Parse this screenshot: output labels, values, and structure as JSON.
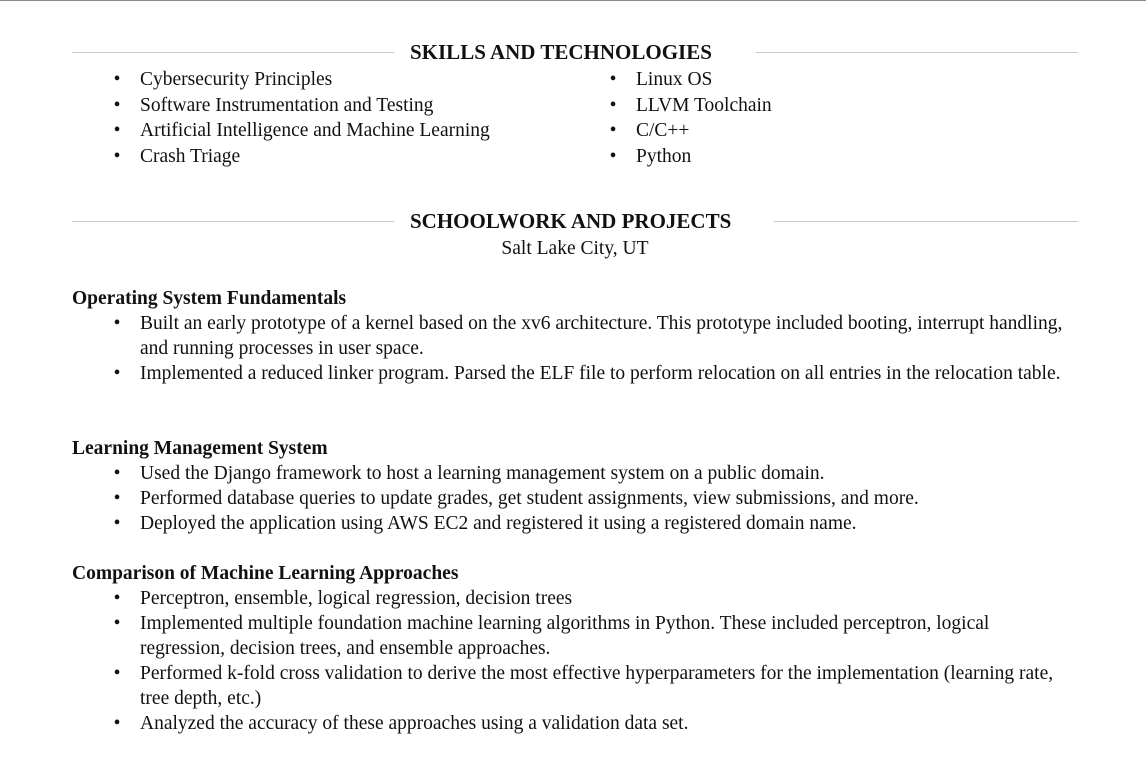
{
  "bullet_glyph": "•",
  "skills": {
    "heading": "SKILLS AND TECHNOLOGIES",
    "left_items": [
      "Cybersecurity Principles",
      "Software Instrumentation and Testing",
      "Artificial Intelligence and Machine Learning",
      "Crash Triage"
    ],
    "right_items": [
      "Linux OS",
      "LLVM Toolchain",
      "C/C++",
      "Python"
    ]
  },
  "projects": {
    "heading": "SCHOOLWORK AND PROJECTS",
    "location": "Salt Lake City, UT",
    "items": [
      {
        "title": "Operating System Fundamentals",
        "bullets": [
          "Built an early prototype of a kernel based on the xv6 architecture. This prototype included booting, interrupt handling, and running processes in user space.",
          "Implemented a reduced linker program. Parsed the ELF file to perform relocation on all entries in the relocation table."
        ]
      },
      {
        "title": "Learning Management System",
        "bullets": [
          "Used the Django framework to host a learning management system on a public domain.",
          "Performed database queries to update grades, get student assignments, view submissions, and more.",
          "Deployed the application using AWS EC2 and registered it using a registered domain name."
        ]
      },
      {
        "title": "Comparison of Machine Learning Approaches",
        "bullets": [
          "Perceptron, ensemble, logical regression, decision trees",
          "Implemented multiple foundation machine learning algorithms in Python. These included perceptron, logical regression, decision trees, and ensemble approaches.",
          "Performed k-fold cross validation to derive the most effective hyperparameters for the implementation (learning rate, tree depth, etc.)",
          "Analyzed the accuracy of these approaches using a validation data set."
        ]
      }
    ]
  }
}
